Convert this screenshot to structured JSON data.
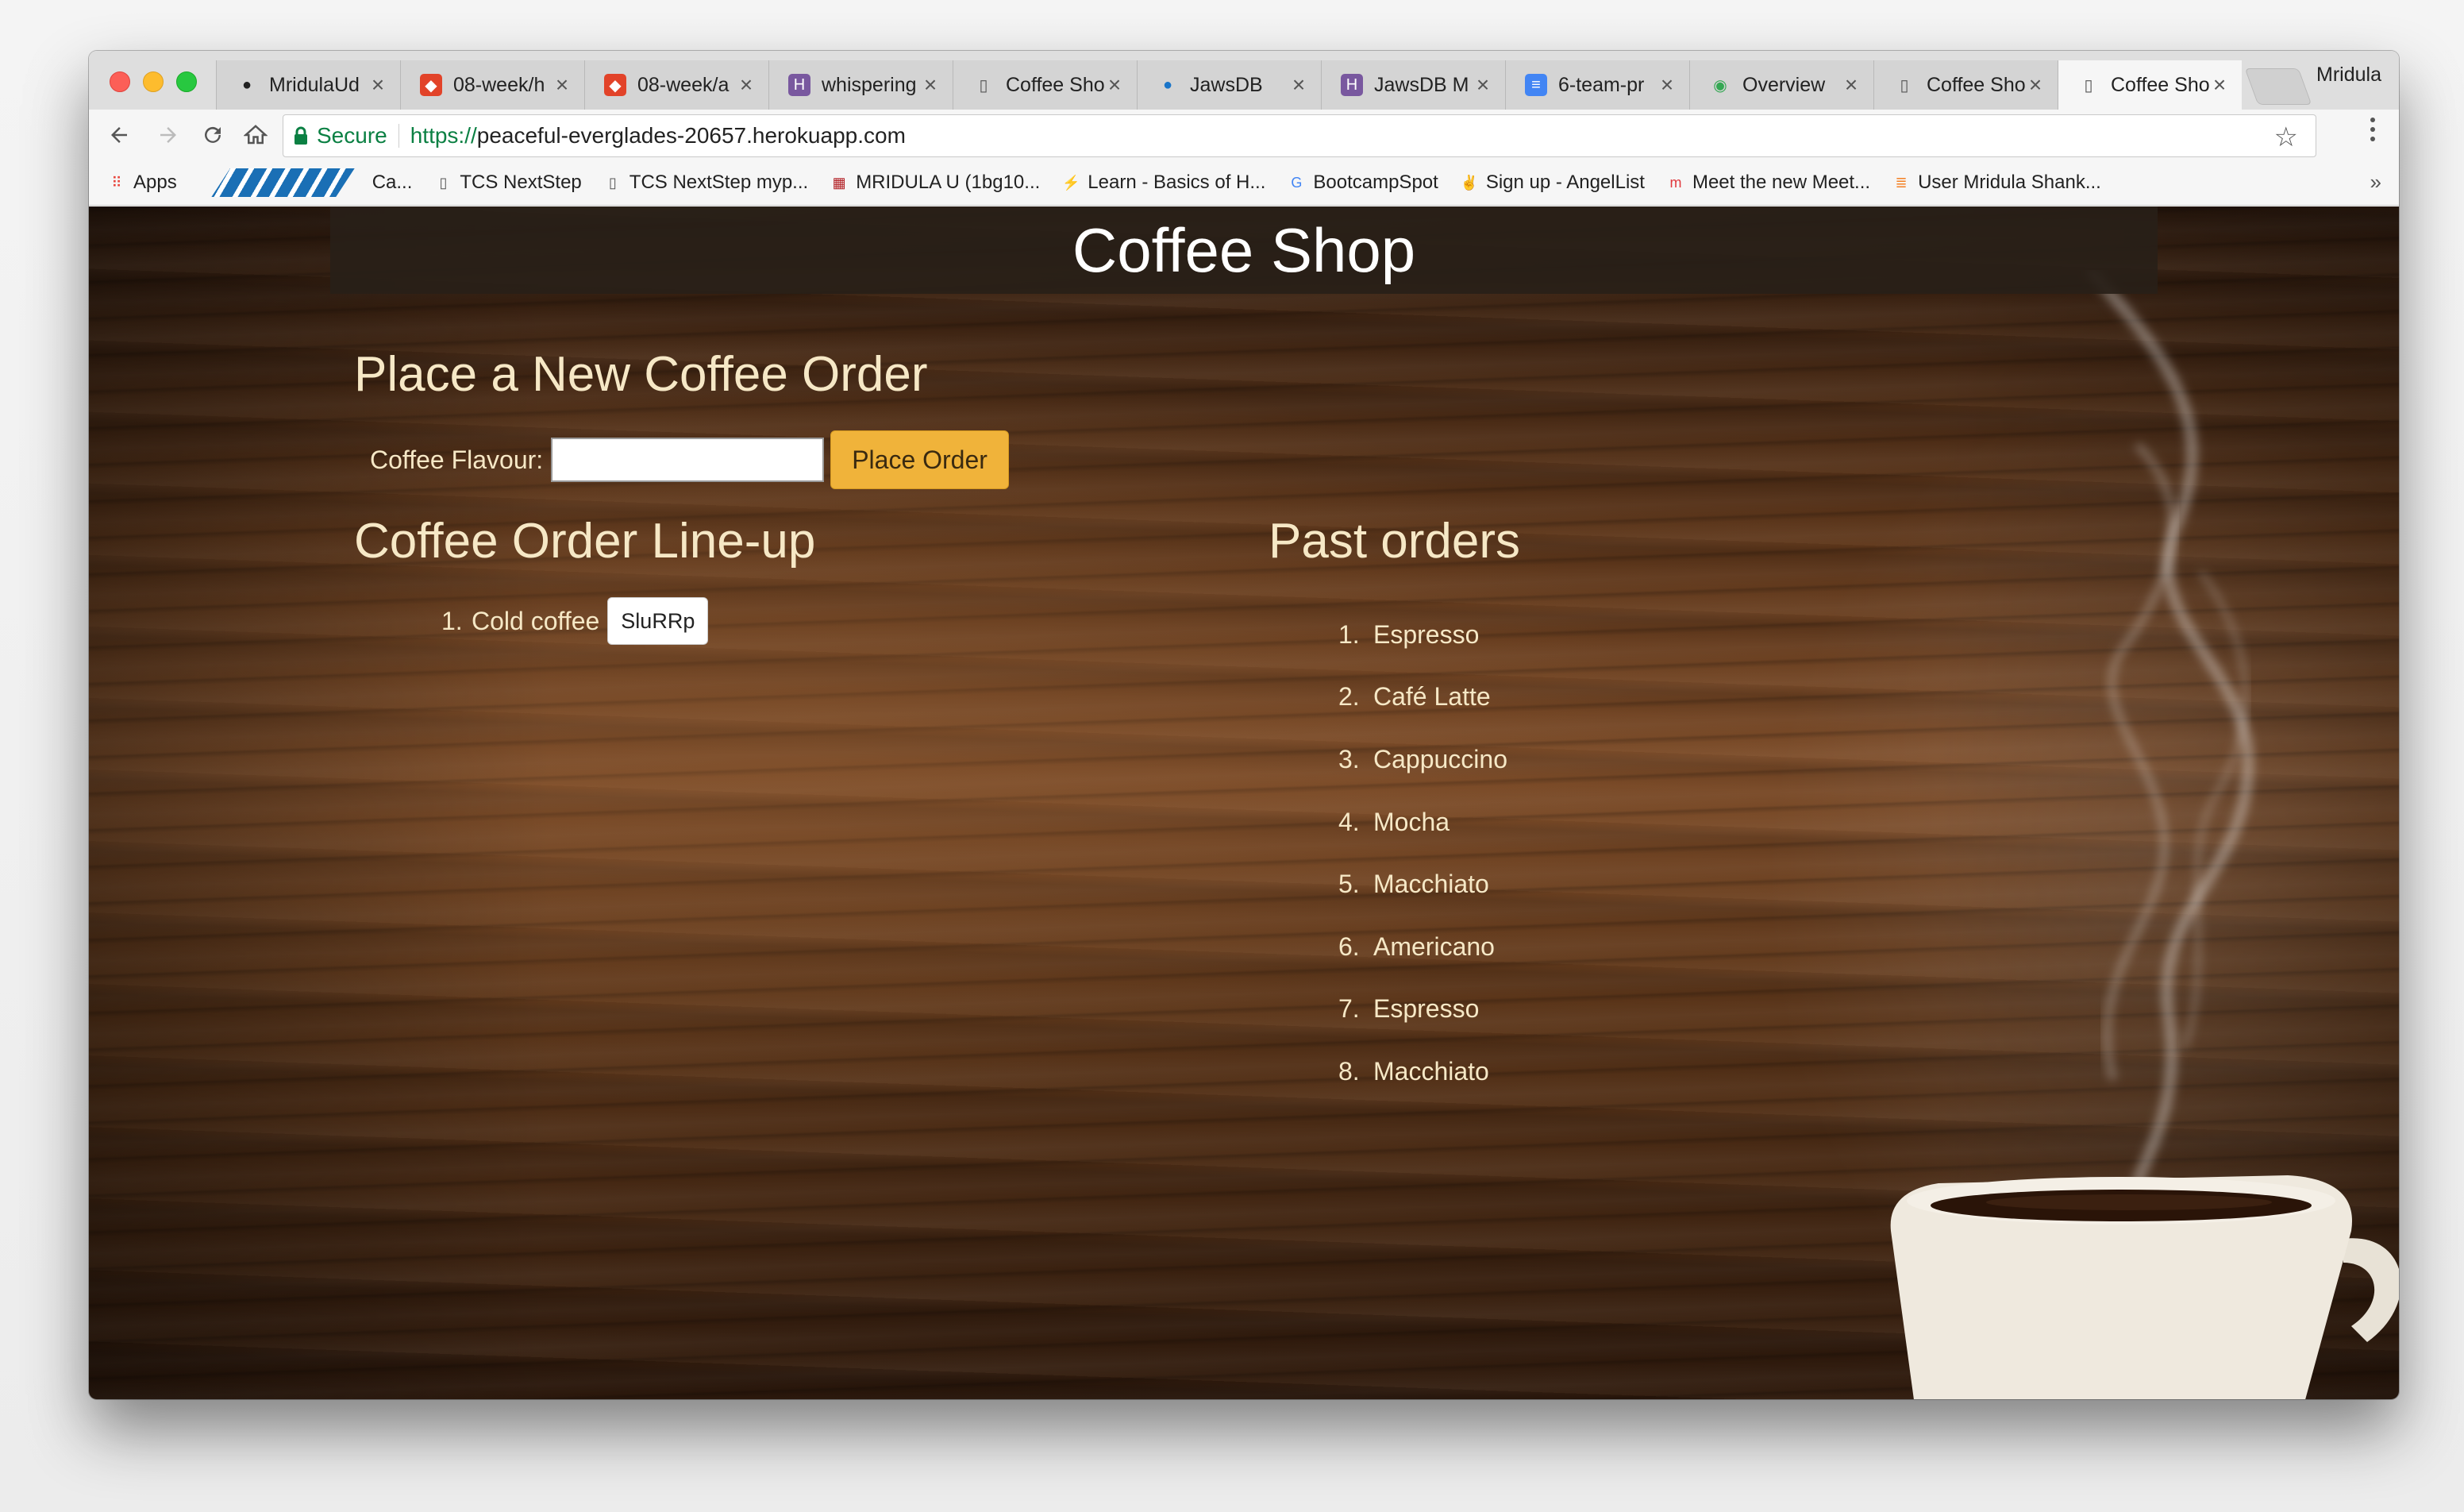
{
  "browser": {
    "profile_name": "Mridula",
    "tabs": [
      {
        "label": "MridulaUd",
        "icon": "github-icon",
        "active": false
      },
      {
        "label": "08-week/h",
        "icon": "gitlab-icon",
        "active": false
      },
      {
        "label": "08-week/a",
        "icon": "gitlab-icon",
        "active": false
      },
      {
        "label": "whispering",
        "icon": "heroku-icon",
        "active": false
      },
      {
        "label": "Coffee Sho",
        "icon": "page-icon",
        "active": false
      },
      {
        "label": "JawsDB",
        "icon": "jawsdb-icon",
        "active": false
      },
      {
        "label": "JawsDB M",
        "icon": "heroku-icon",
        "active": false
      },
      {
        "label": "6-team-pr",
        "icon": "docs-icon",
        "active": false
      },
      {
        "label": "Overview",
        "icon": "chrome-icon",
        "active": false
      },
      {
        "label": "Coffee Sho",
        "icon": "page-icon",
        "active": false
      },
      {
        "label": "Coffee Sho",
        "icon": "page-icon",
        "active": true
      }
    ],
    "address": {
      "secure_label": "Secure",
      "scheme": "https://",
      "host": "peaceful-everglades-20657.herokuapp.com"
    },
    "bookmarks": [
      {
        "label": "Apps",
        "icon": "apps-grid-icon"
      },
      {
        "label": "Ca...",
        "icon": "stripe-logo-icon"
      },
      {
        "label": "TCS NextStep",
        "icon": "page-icon"
      },
      {
        "label": "TCS NextStep myp...",
        "icon": "page-icon"
      },
      {
        "label": "MRIDULA U (1bg10...",
        "icon": "vtu-icon"
      },
      {
        "label": "Learn - Basics of H...",
        "icon": "learn-icon"
      },
      {
        "label": "BootcampSpot",
        "icon": "google-icon"
      },
      {
        "label": "Sign up - AngelList",
        "icon": "angellist-icon"
      },
      {
        "label": "Meet the new Meet...",
        "icon": "meetup-icon"
      },
      {
        "label": "User Mridula Shank...",
        "icon": "stackoverflow-icon"
      }
    ]
  },
  "page": {
    "title": "Coffee Shop",
    "new_order": {
      "heading": "Place a New Coffee Order",
      "flavour_label": "Coffee Flavour:",
      "flavour_value": "",
      "button_label": "Place Order"
    },
    "lineup": {
      "heading": "Coffee Order Line-up",
      "items": [
        {
          "num": "1.",
          "name": "Cold coffee",
          "action": "SluRRp"
        }
      ]
    },
    "past": {
      "heading": "Past orders",
      "items": [
        {
          "num": "1.",
          "name": "Espresso"
        },
        {
          "num": "2.",
          "name": "Café Latte"
        },
        {
          "num": "3.",
          "name": "Cappuccino"
        },
        {
          "num": "4.",
          "name": "Mocha"
        },
        {
          "num": "5.",
          "name": "Macchiato"
        },
        {
          "num": "6.",
          "name": "Americano"
        },
        {
          "num": "7.",
          "name": "Espresso"
        },
        {
          "num": "8.",
          "name": "Macchiato"
        }
      ]
    }
  },
  "colors": {
    "accent_button": "#f0b33a",
    "secure_green": "#0b8043",
    "heading_text": "#f6e8c6"
  }
}
